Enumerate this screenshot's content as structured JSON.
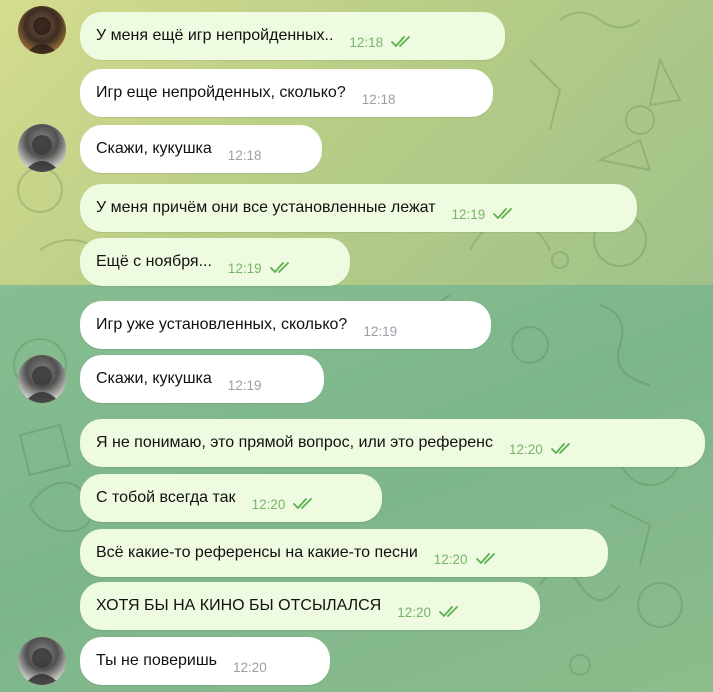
{
  "messages": [
    {
      "id": "m1",
      "dir": "out",
      "text": "У меня ещё игр непройденных..",
      "time": "12:18",
      "read": true
    },
    {
      "id": "m2",
      "dir": "in",
      "text": "Игр еще непройденных, сколько?",
      "time": "12:18"
    },
    {
      "id": "m3",
      "dir": "in",
      "text": "Скажи, кукушка",
      "time": "12:18"
    },
    {
      "id": "m4",
      "dir": "out",
      "text": "У меня причём они все установленные лежат",
      "time": "12:19",
      "read": true
    },
    {
      "id": "m5",
      "dir": "out",
      "text": "Ещё с ноября...",
      "time": "12:19",
      "read": true
    },
    {
      "id": "m6",
      "dir": "in",
      "text": "Игр уже установленных, сколько?",
      "time": "12:19"
    },
    {
      "id": "m7",
      "dir": "in",
      "text": "Скажи, кукушка",
      "time": "12:19"
    },
    {
      "id": "m8",
      "dir": "out",
      "text": "Я не понимаю, это прямой вопрос, или это референс",
      "time": "12:20",
      "read": true
    },
    {
      "id": "m9",
      "dir": "out",
      "text": "С тобой всегда так",
      "time": "12:20",
      "read": true
    },
    {
      "id": "m10",
      "dir": "out",
      "text": "Всё какие-то референсы на какие-то песни",
      "time": "12:20",
      "read": true
    },
    {
      "id": "m11",
      "dir": "out",
      "text": "ХОТЯ БЫ НА КИНО БЫ ОТСЫЛАЛСЯ",
      "time": "12:20",
      "read": true
    },
    {
      "id": "m12",
      "dir": "in",
      "text": "Ты не поверишь",
      "time": "12:20"
    }
  ],
  "colors": {
    "bubble_in": "#ffffff",
    "bubble_out": "#eefbe0",
    "read_check": "#5cb04f",
    "time_in": "#9aa0a6",
    "time_out": "#79b46c",
    "wallpaper_top": "#c4d58b",
    "wallpaper_bottom": "#82b98e"
  },
  "icons": {
    "read_receipt": "double-check-icon",
    "avatar": "user-avatar"
  }
}
